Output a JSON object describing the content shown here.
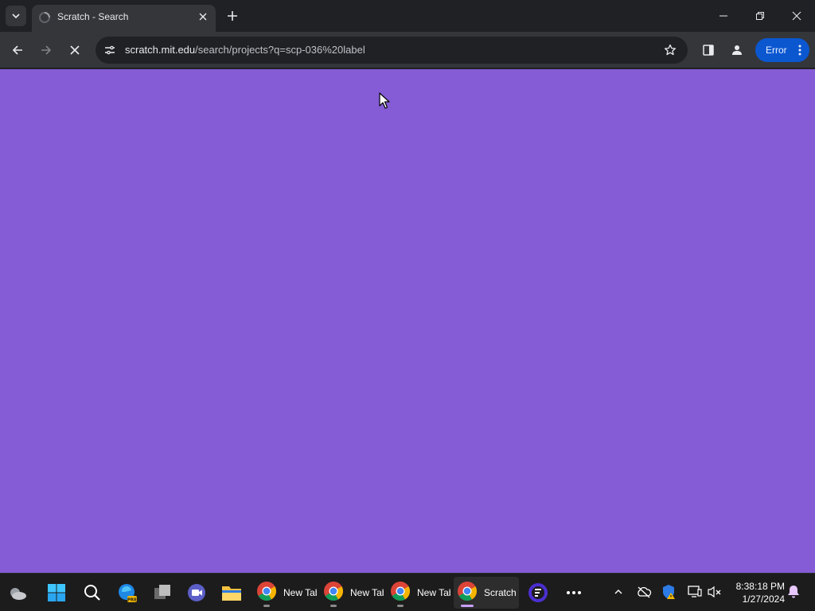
{
  "tab": {
    "title": "Scratch - Search",
    "favicon": "loading-spinner-icon"
  },
  "toolbar": {
    "url_host": "scratch.mit.edu",
    "url_path": "/search/projects?q=scp-036%20label",
    "profile_status": "Error"
  },
  "page": {
    "background": "#855cd6"
  },
  "taskbar": {
    "apps": [
      {
        "label": "New Tab",
        "icon": "chrome-icon"
      },
      {
        "label": "New Tab",
        "icon": "chrome-icon"
      },
      {
        "label": "New Tab",
        "icon": "chrome-icon"
      },
      {
        "label": "Scratch",
        "icon": "chrome-icon"
      }
    ],
    "time": "8:38:18 PM",
    "date": "1/27/2024"
  },
  "colors": {
    "accent": "#0b57d0",
    "scratch_purple": "#855cd6",
    "browser_chrome": "#35363a"
  }
}
